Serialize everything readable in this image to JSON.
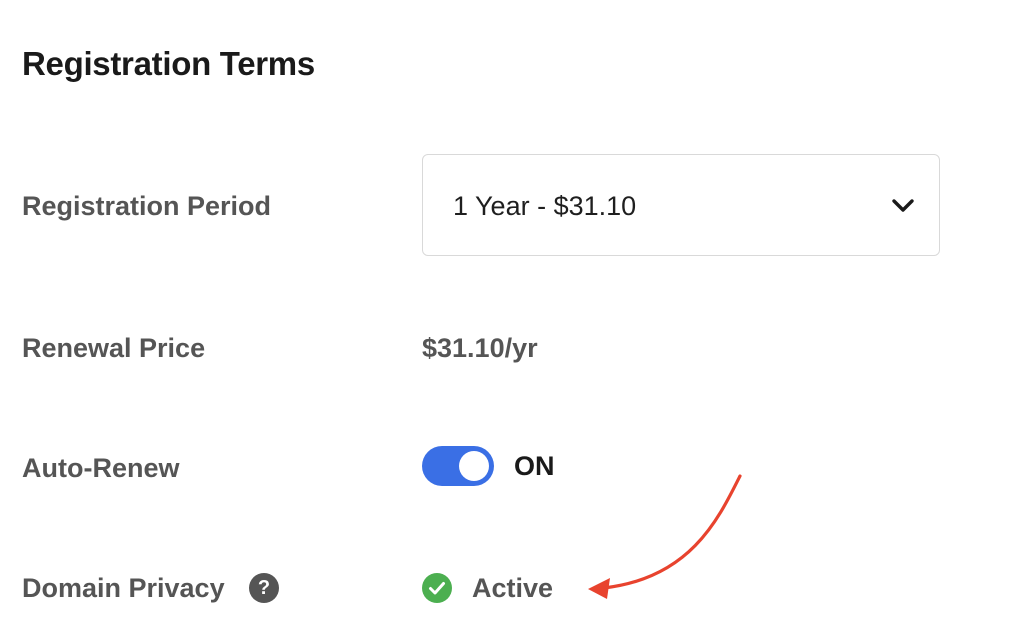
{
  "section": {
    "title": "Registration Terms"
  },
  "registration_period": {
    "label": "Registration Period",
    "selected": "1 Year - $31.10"
  },
  "renewal": {
    "label": "Renewal Price",
    "value": "$31.10/yr"
  },
  "auto_renew": {
    "label": "Auto-Renew",
    "state": "ON",
    "enabled": true
  },
  "domain_privacy": {
    "label": "Domain Privacy",
    "help_glyph": "?",
    "status": "Active"
  },
  "colors": {
    "toggle_on": "#3a6fe5",
    "check_green": "#4caf50",
    "annotation_arrow": "#e8432e",
    "label_text": "#555555",
    "title_text": "#1a1a1a"
  },
  "icons": {
    "dropdown": "chevron-down-icon",
    "help": "question-mark-icon",
    "status": "check-circle-icon",
    "annotation": "arrow-annotation-icon"
  }
}
